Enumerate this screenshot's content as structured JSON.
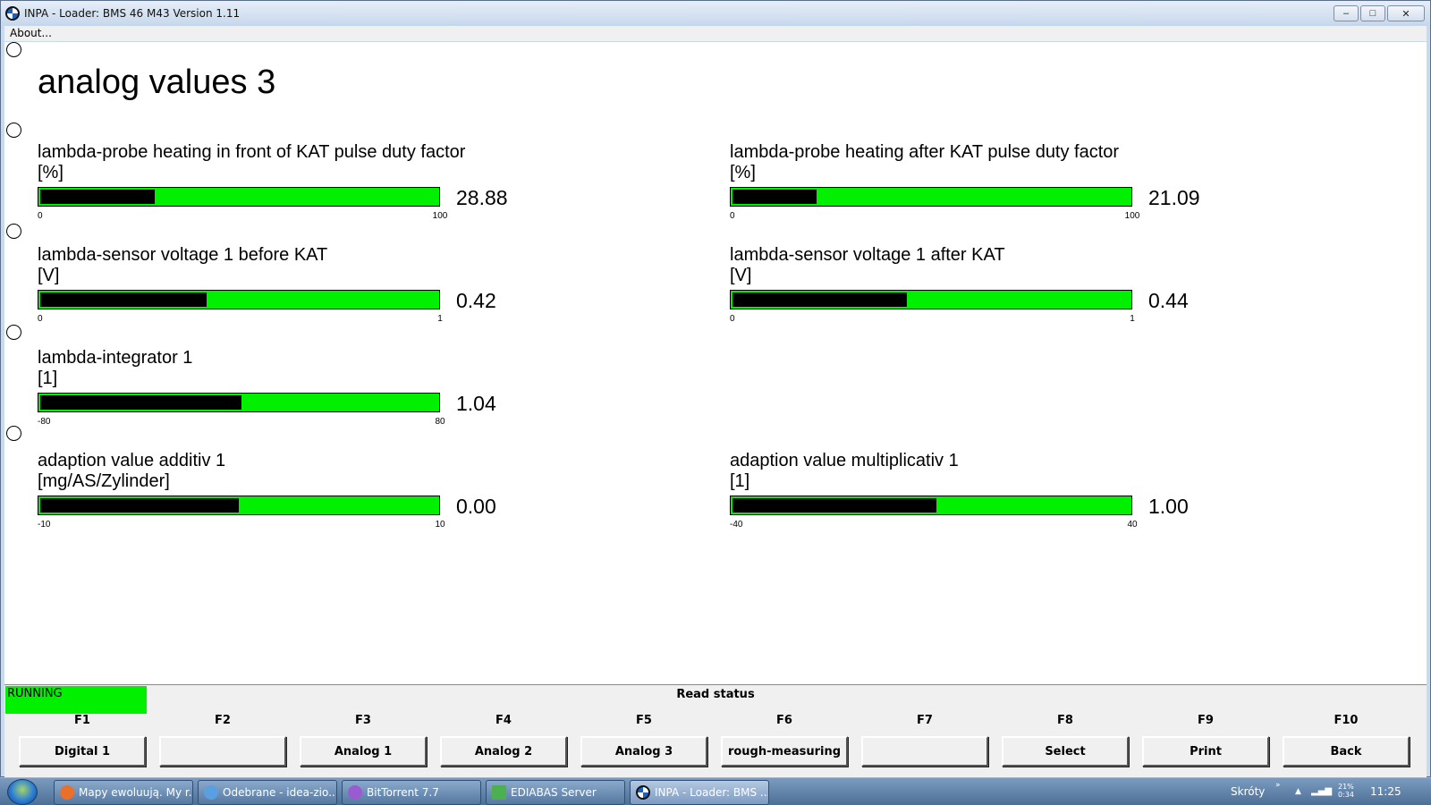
{
  "window": {
    "title": "INPA - Loader:  BMS 46 M43 Version 1.11",
    "menu": {
      "about_label": "About..."
    }
  },
  "page": {
    "title": "analog values 3"
  },
  "meters": [
    {
      "label": "lambda-probe heating in front of KAT pulse duty factor",
      "unit": "[%]",
      "value": "28.88",
      "min": "0",
      "max": "100",
      "fill_fraction": 0.2888
    },
    {
      "label": "lambda-probe heating after KAT pulse duty factor",
      "unit": "[%]",
      "value": "21.09",
      "min": "0",
      "max": "100",
      "fill_fraction": 0.2109
    },
    {
      "label": "lambda-sensor voltage 1 before KAT",
      "unit": "[V]",
      "value": "0.42",
      "min": "0",
      "max": "1",
      "fill_fraction": 0.42
    },
    {
      "label": "lambda-sensor voltage 1 after KAT",
      "unit": "[V]",
      "value": "0.44",
      "min": "0",
      "max": "1",
      "fill_fraction": 0.44
    },
    {
      "label": "lambda-integrator 1",
      "unit": "[1]",
      "value": "1.04",
      "min": "-80",
      "max": "80",
      "fill_fraction": 0.5065
    },
    {
      "label": "adaption value additiv 1",
      "unit": "[mg/AS/Zylinder]",
      "value": "0.00",
      "min": "-10",
      "max": "10",
      "fill_fraction": 0.5
    },
    {
      "label": "adaption value multiplicativ 1",
      "unit": "[1]",
      "value": "1.00",
      "min": "-40",
      "max": "40",
      "fill_fraction": 0.5125
    }
  ],
  "status": {
    "running": "RUNNING",
    "read_status": "Read status"
  },
  "fkeys": [
    {
      "key": "F1",
      "label": "Digital 1"
    },
    {
      "key": "F2",
      "label": ""
    },
    {
      "key": "F3",
      "label": "Analog 1"
    },
    {
      "key": "F4",
      "label": "Analog 2"
    },
    {
      "key": "F5",
      "label": "Analog 3"
    },
    {
      "key": "F6",
      "label": "rough-measuring"
    },
    {
      "key": "F7",
      "label": ""
    },
    {
      "key": "F8",
      "label": "Select"
    },
    {
      "key": "F9",
      "label": "Print"
    },
    {
      "key": "F10",
      "label": "Back"
    }
  ],
  "taskbar": {
    "items": [
      {
        "label": "Mapy ewoluują. My r...",
        "icon": "firefox-icon"
      },
      {
        "label": "Odebrane - idea-zio...",
        "icon": "mail-icon"
      },
      {
        "label": "BitTorrent 7.7",
        "icon": "bittorrent-icon"
      },
      {
        "label": "EDIABAS Server",
        "icon": "server-icon"
      },
      {
        "label": "INPA - Loader:  BMS ...",
        "icon": "bmw-icon"
      }
    ],
    "shortcuts_label": "Skróty",
    "battery": "21%\n0:34",
    "clock": "11:25"
  },
  "colors": {
    "bar_green": "#00f000",
    "bar_fill": "#000000"
  }
}
